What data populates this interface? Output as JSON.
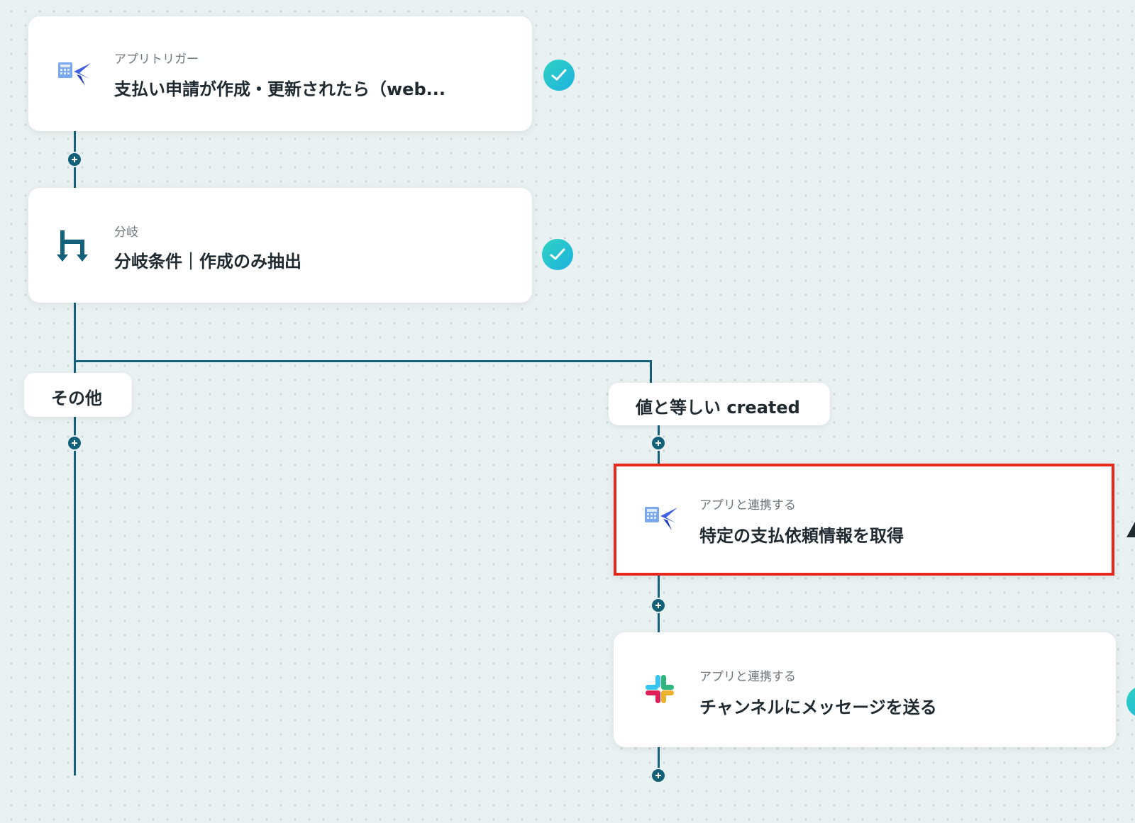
{
  "flow": {
    "trigger": {
      "subtitle": "アプリトリガー",
      "title": "支払い申請が作成・更新されたら（web..."
    },
    "branch": {
      "subtitle": "分岐",
      "title": "分岐条件｜作成のみ抽出"
    },
    "branch_labels": {
      "other": "その他",
      "equals": "値と等しい created"
    },
    "step_get": {
      "subtitle": "アプリと連携する",
      "title": "特定の支払依頼情報を取得"
    },
    "step_slack": {
      "subtitle": "アプリと連携する",
      "title": "チャンネルにメッセージを送る"
    }
  },
  "icons": {
    "trigger": "payment-app-icon",
    "branch": "branch-icon",
    "step_get": "payment-app-icon",
    "step_slack": "slack-icon",
    "status": "check-icon",
    "add": "plus-icon"
  },
  "colors": {
    "connector": "#12607a",
    "check_start": "#2fd3c2",
    "check_end": "#1db1e0",
    "selection": "#e8281c",
    "canvas": "#eaf1f2"
  }
}
